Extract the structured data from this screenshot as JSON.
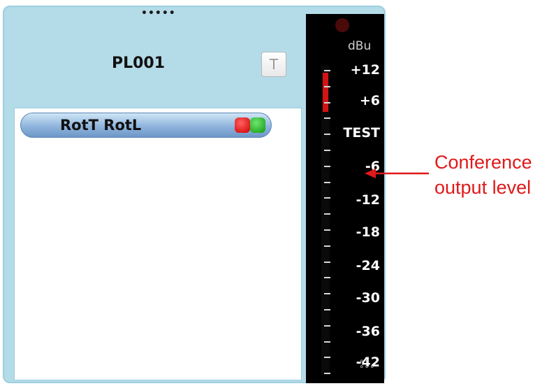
{
  "panel": {
    "drag_handle": "•••••",
    "title": "PL001",
    "t_button_label": "T",
    "party": {
      "label": "RotT RotL",
      "indicators": [
        {
          "name": "red",
          "color": "#e01010"
        },
        {
          "name": "green",
          "color": "#18a818"
        }
      ]
    }
  },
  "meter": {
    "unit": "dBu",
    "scale_labels": [
      "+12",
      "+6",
      "TEST",
      "-6",
      "-12",
      "-18",
      "-24",
      "-30",
      "-36",
      "-42"
    ],
    "peak_lamp_color": "#4a0a0a",
    "level_color": "#d21414",
    "handle": "∘∘\n∘∘∘"
  },
  "annotation": {
    "line1": "Conference",
    "line2": "output level",
    "color": "#e0191a"
  }
}
